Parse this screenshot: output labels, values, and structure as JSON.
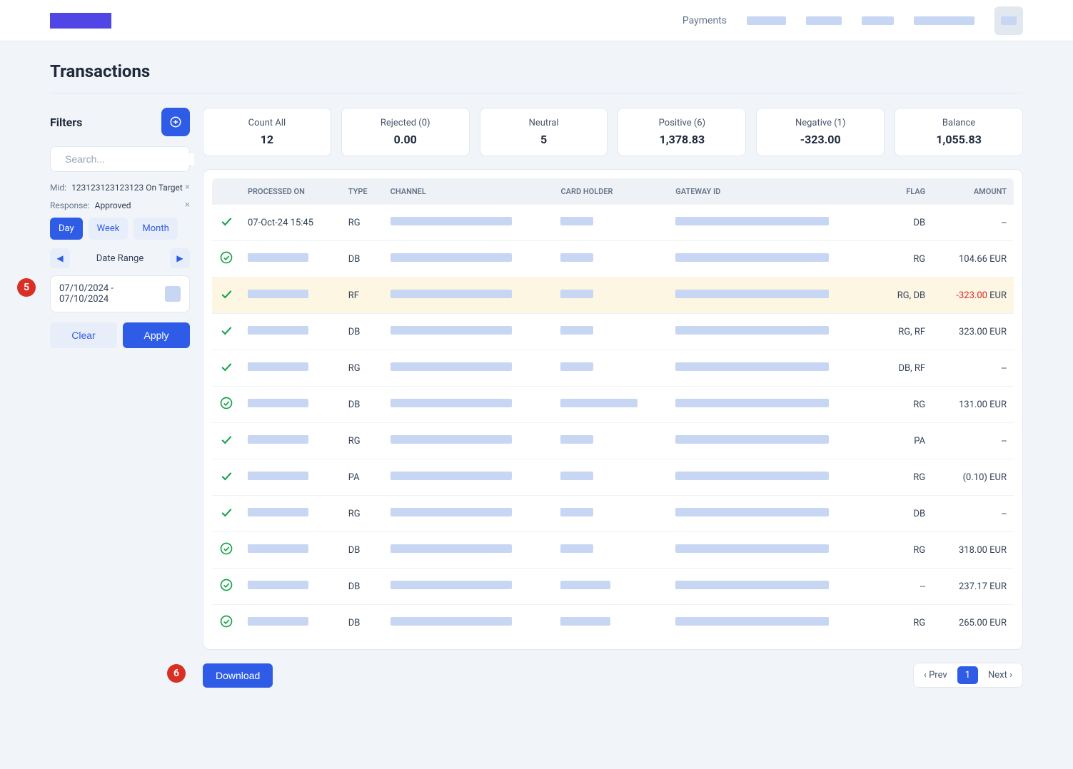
{
  "header": {
    "nav_payments": "Payments"
  },
  "page": {
    "title": "Transactions"
  },
  "filters": {
    "title": "Filters",
    "search_placeholder": "Search...",
    "mid_label": "Mid:",
    "mid_value": "123123123123123 On Target",
    "response_label": "Response:",
    "response_value": "Approved",
    "period_day": "Day",
    "period_week": "Week",
    "period_month": "Month",
    "date_range_label": "Date Range",
    "date_range_value": "07/10/2024 - 07/10/2024",
    "clear": "Clear",
    "apply": "Apply"
  },
  "annotations": {
    "marker5": "5",
    "marker6": "6"
  },
  "stats": [
    {
      "label": "Count All",
      "value": "12"
    },
    {
      "label": "Rejected (0)",
      "value": "0.00"
    },
    {
      "label": "Neutral",
      "value": "5"
    },
    {
      "label": "Positive (6)",
      "value": "1,378.83"
    },
    {
      "label": "Negative (1)",
      "value": "-323.00"
    },
    {
      "label": "Balance",
      "value": "1,055.83"
    }
  ],
  "table": {
    "headers": {
      "processed": "Processed On",
      "type": "Type",
      "channel": "Channel",
      "cardholder": "Card Holder",
      "gateway": "Gateway ID",
      "flag": "Flag",
      "amount": "Amount"
    },
    "rows": [
      {
        "status": "check",
        "processed": "07-Oct-24 15:45",
        "type": "RG",
        "card_w": "sm",
        "flag": "DB",
        "amount": "--",
        "amount_neg": false,
        "highlight": false
      },
      {
        "status": "circle",
        "processed": "",
        "type": "DB",
        "card_w": "sm",
        "flag": "RG",
        "amount": "104.66 EUR",
        "amount_neg": false,
        "highlight": false
      },
      {
        "status": "check",
        "processed": "",
        "type": "RF",
        "card_w": "sm",
        "flag": "RG, DB",
        "amount": "-323.00 EUR",
        "amount_neg": true,
        "highlight": true
      },
      {
        "status": "check",
        "processed": "",
        "type": "DB",
        "card_w": "sm",
        "flag": "RG, RF",
        "amount": "323.00 EUR",
        "amount_neg": false,
        "highlight": false
      },
      {
        "status": "check",
        "processed": "",
        "type": "RG",
        "card_w": "sm",
        "flag": "DB, RF",
        "amount": "--",
        "amount_neg": false,
        "highlight": false
      },
      {
        "status": "circle",
        "processed": "",
        "type": "DB",
        "card_w": "lg",
        "flag": "RG",
        "amount": "131.00 EUR",
        "amount_neg": false,
        "highlight": false
      },
      {
        "status": "check",
        "processed": "",
        "type": "RG",
        "card_w": "sm",
        "flag": "PA",
        "amount": "--",
        "amount_neg": false,
        "highlight": false
      },
      {
        "status": "check",
        "processed": "",
        "type": "PA",
        "card_w": "sm",
        "flag": "RG",
        "amount": "(0.10) EUR",
        "amount_neg": false,
        "highlight": false
      },
      {
        "status": "check",
        "processed": "",
        "type": "RG",
        "card_w": "sm",
        "flag": "DB",
        "amount": "--",
        "amount_neg": false,
        "highlight": false
      },
      {
        "status": "circle",
        "processed": "",
        "type": "DB",
        "card_w": "sm",
        "flag": "RG",
        "amount": "318.00 EUR",
        "amount_neg": false,
        "highlight": false
      },
      {
        "status": "circle",
        "processed": "",
        "type": "DB",
        "card_w": "md",
        "flag": "--",
        "amount": "237.17 EUR",
        "amount_neg": false,
        "highlight": false
      },
      {
        "status": "circle",
        "processed": "",
        "type": "DB",
        "card_w": "md",
        "flag": "RG",
        "amount": "265.00 EUR",
        "amount_neg": false,
        "highlight": false
      }
    ]
  },
  "footer": {
    "download": "Download",
    "prev": "‹ Prev",
    "page": "1",
    "next": "Next ›"
  }
}
